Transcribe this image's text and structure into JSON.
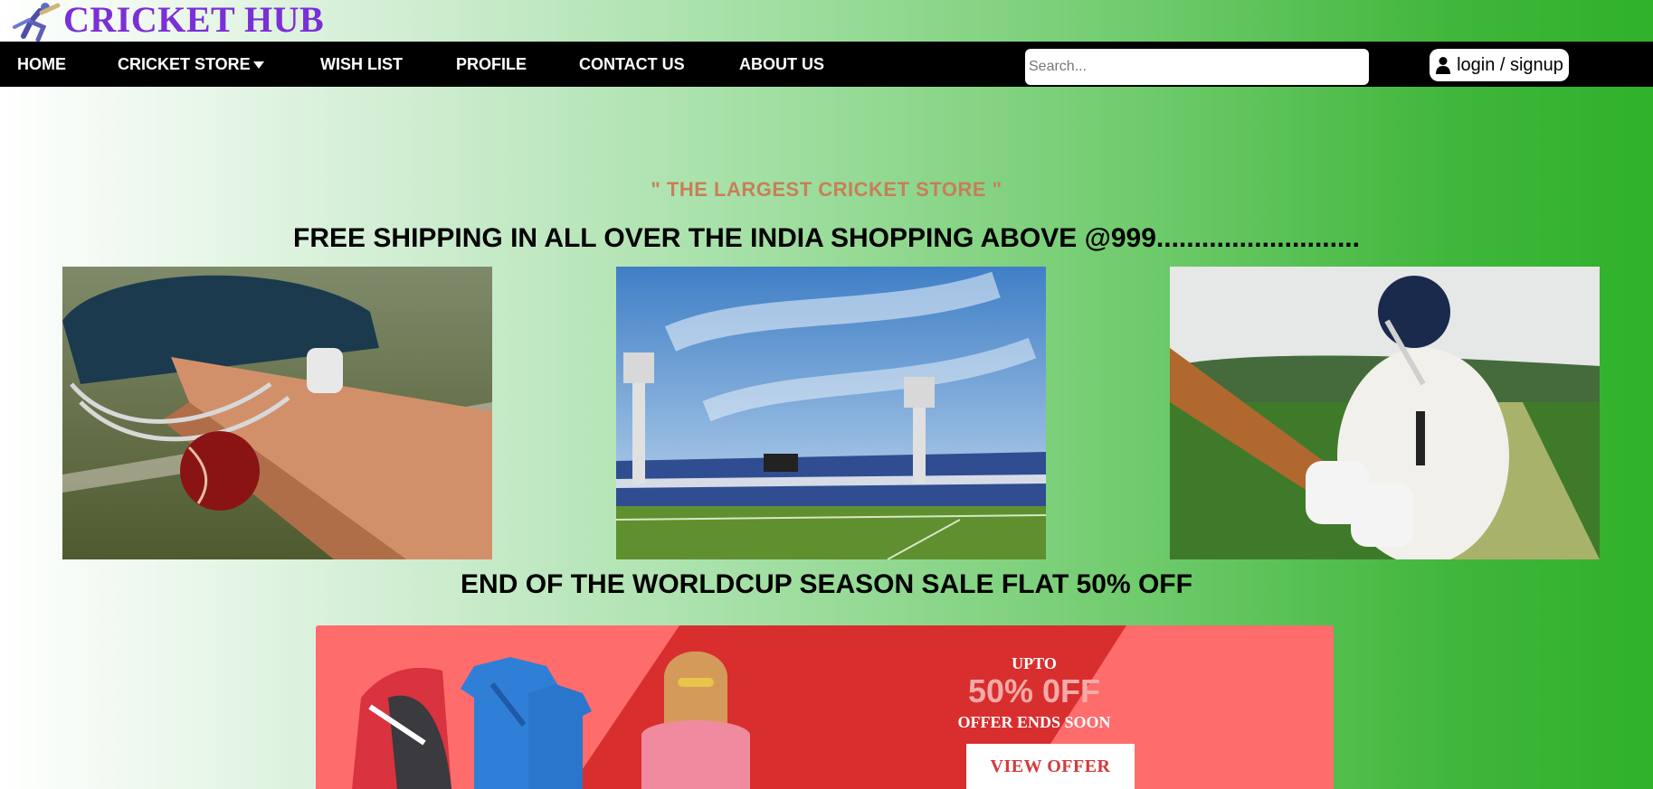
{
  "brand": {
    "name": "CRICKET HUB",
    "logo_icon": "batsman-logo-icon"
  },
  "nav": {
    "items": [
      {
        "label": "HOME"
      },
      {
        "label": "CRICKET STORE",
        "has_dropdown": true
      },
      {
        "label": "WISH LIST"
      },
      {
        "label": "PROFILE"
      },
      {
        "label": "CONTACT US"
      },
      {
        "label": "ABOUT US"
      }
    ]
  },
  "search": {
    "placeholder": "Search...",
    "value": ""
  },
  "auth": {
    "label": "login / signup",
    "icon": "user-icon"
  },
  "hero": {
    "tagline": "\" THE LARGEST CRICKET STORE \"",
    "shipping": "FREE SHIPPING IN ALL OVER THE INDIA SHOPPING ABOVE @999...........................",
    "photos": [
      {
        "icon": "helmet-bat-ball-image"
      },
      {
        "icon": "stadium-image"
      },
      {
        "icon": "batsman-image"
      }
    ],
    "sale_heading": "END OF THE WORLDCUP SEASON SALE FLAT 50% OFF"
  },
  "offer": {
    "upto": "UPTO",
    "percent": "50% 0FF",
    "ends": "OFFER ENDS SOON",
    "button": "VIEW OFFER",
    "colors": {
      "base": "#fe6c6c",
      "stripe": "#d92e2e",
      "button_text": "#d33a3a"
    }
  },
  "colors": {
    "brand": "#7b2fd6",
    "tagline": "#c77f58",
    "navbar": "#000000",
    "gradient_end": "#2fb12a"
  }
}
